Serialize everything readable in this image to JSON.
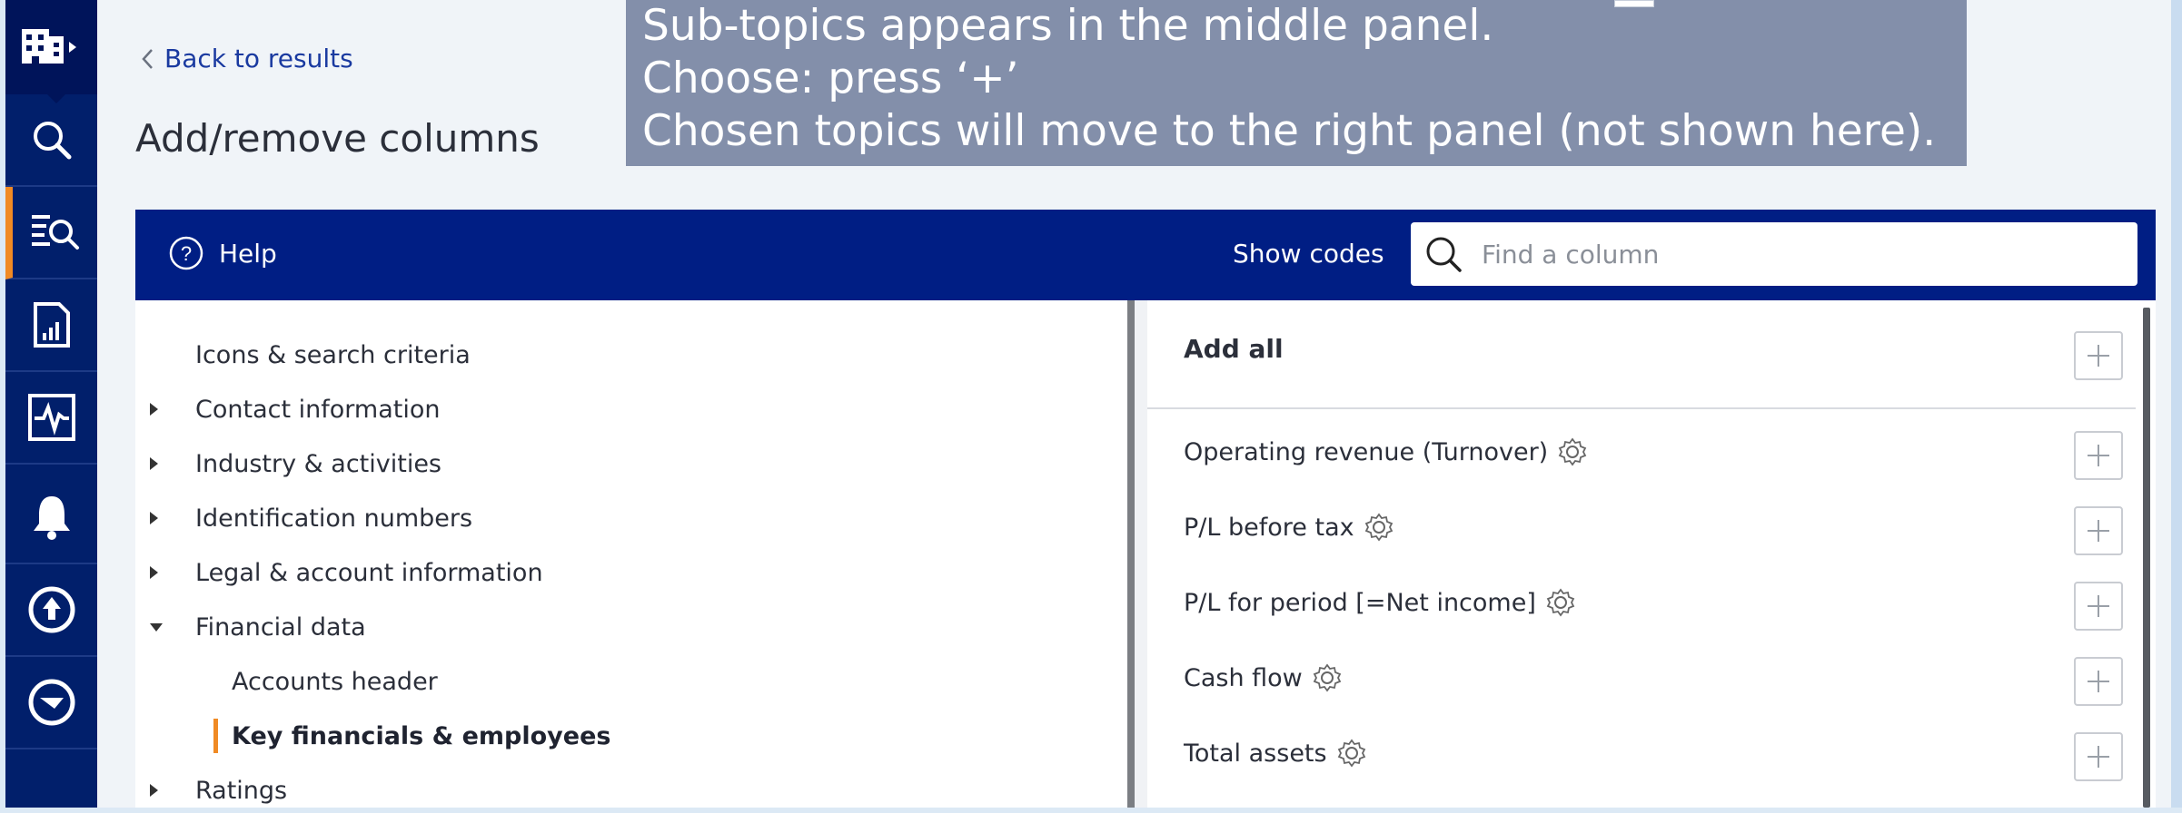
{
  "rail": {
    "items": [
      {
        "name": "companies-icon"
      },
      {
        "name": "search-icon"
      },
      {
        "name": "search-results-icon"
      },
      {
        "name": "reports-icon"
      },
      {
        "name": "monitoring-icon"
      },
      {
        "name": "alerts-icon"
      },
      {
        "name": "upload-icon"
      },
      {
        "name": "download-icon"
      }
    ]
  },
  "header": {
    "back_label": "Back to results",
    "title": "Add/remove columns"
  },
  "toolbar": {
    "help_label": "Help",
    "show_codes_label": "Show codes",
    "search_placeholder": "Find a column"
  },
  "tree": {
    "items": [
      {
        "label": "Icons & search criteria"
      },
      {
        "label": "Contact information"
      },
      {
        "label": "Industry & activities"
      },
      {
        "label": "Identification numbers"
      },
      {
        "label": "Legal & account information"
      },
      {
        "label": "Financial data"
      },
      {
        "label": "Accounts header"
      },
      {
        "label": "Key financials & employees"
      },
      {
        "label": "Ratings"
      }
    ]
  },
  "list": {
    "add_all_label": "Add all",
    "items": [
      {
        "label": "Operating revenue (Turnover)"
      },
      {
        "label": "P/L before tax"
      },
      {
        "label": "P/L for period [=Net income]"
      },
      {
        "label": "Cash flow"
      },
      {
        "label": "Total assets"
      }
    ]
  },
  "tooltip": {
    "line1": "Sub-topics appears in the middle panel.",
    "line2": "Choose: press ‘+’",
    "line3": "Chosen topics will move to the right panel (not shown here)."
  },
  "colors": {
    "rail": "#011f6b",
    "toolbar": "#001e84",
    "accent": "#f08a24",
    "link": "#1a3aa0"
  }
}
